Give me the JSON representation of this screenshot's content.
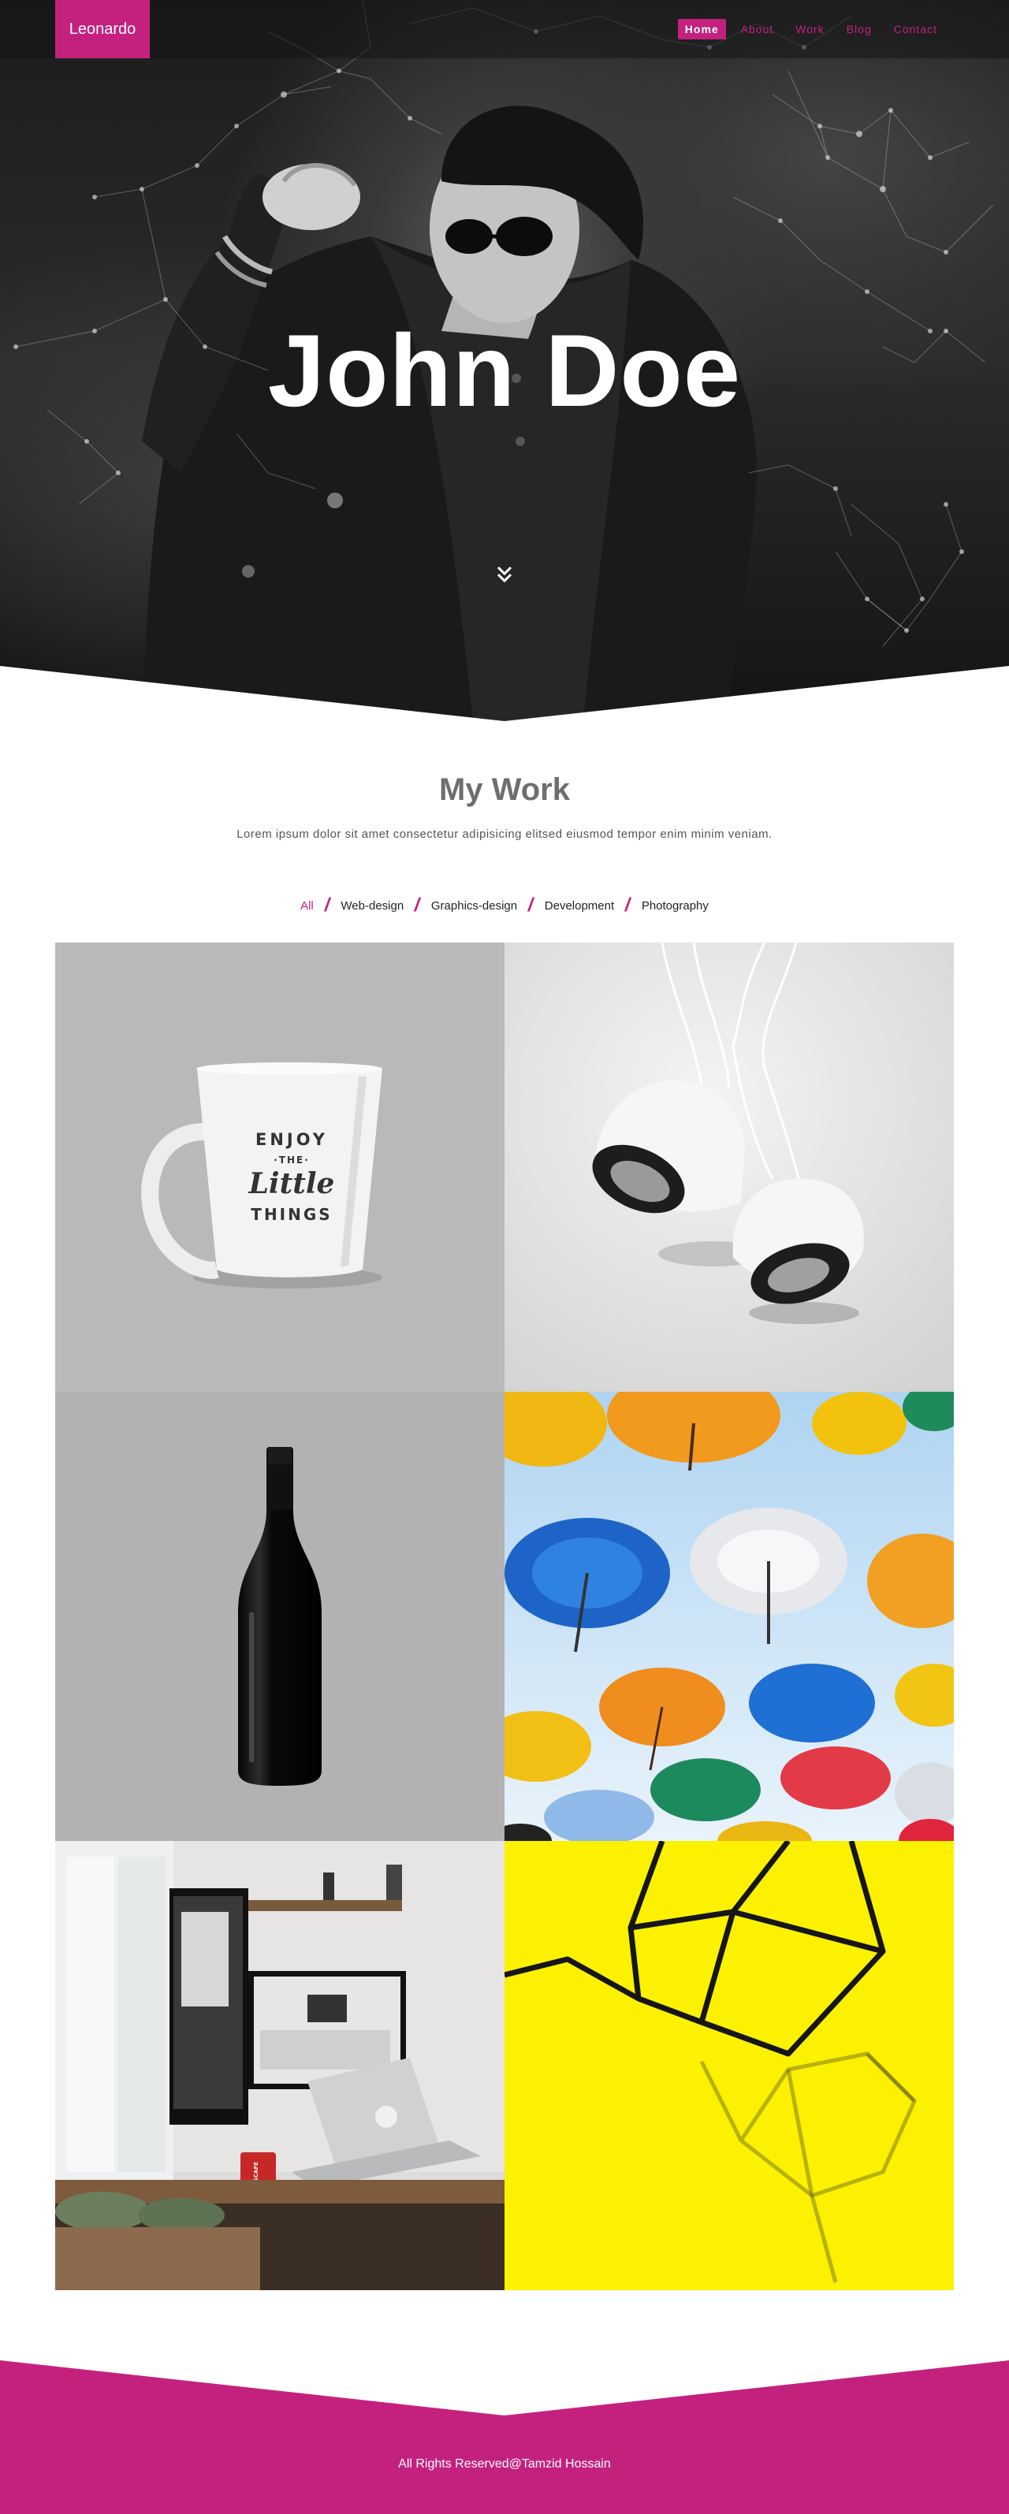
{
  "brand": "Leonardo",
  "nav": {
    "items": [
      {
        "label": "Home",
        "active": true
      },
      {
        "label": "About",
        "active": false
      },
      {
        "label": "Work",
        "active": false
      },
      {
        "label": "Blog",
        "active": false
      },
      {
        "label": "Contact",
        "active": false
      }
    ]
  },
  "hero": {
    "title": "John Doe",
    "scroll_icon": "double-chevron-down-icon"
  },
  "work": {
    "title": "My Work",
    "subtitle": "Lorem ipsum dolor sit amet consectetur adipisicing elitsed eiusmod tempor enim minim veniam.",
    "filters": [
      "All",
      "Web-design",
      "Graphics-design",
      "Development",
      "Photography"
    ],
    "active_filter": "All",
    "items": [
      {
        "image": "mug",
        "mug_text": [
          "ENJOY",
          "·THE·",
          "Little",
          "THINGS"
        ]
      },
      {
        "image": "speakers"
      },
      {
        "image": "wine-bottle"
      },
      {
        "image": "umbrellas"
      },
      {
        "image": "desk-setup",
        "mug_brand": "NESCAFE"
      },
      {
        "image": "geometric-lamp"
      }
    ]
  },
  "footer": {
    "text": "All Rights Reserved@Tamzid Hossain"
  },
  "colors": {
    "accent": "#c4217f",
    "heading": "#6e6e6e",
    "footer_bg": "#c4217f"
  }
}
